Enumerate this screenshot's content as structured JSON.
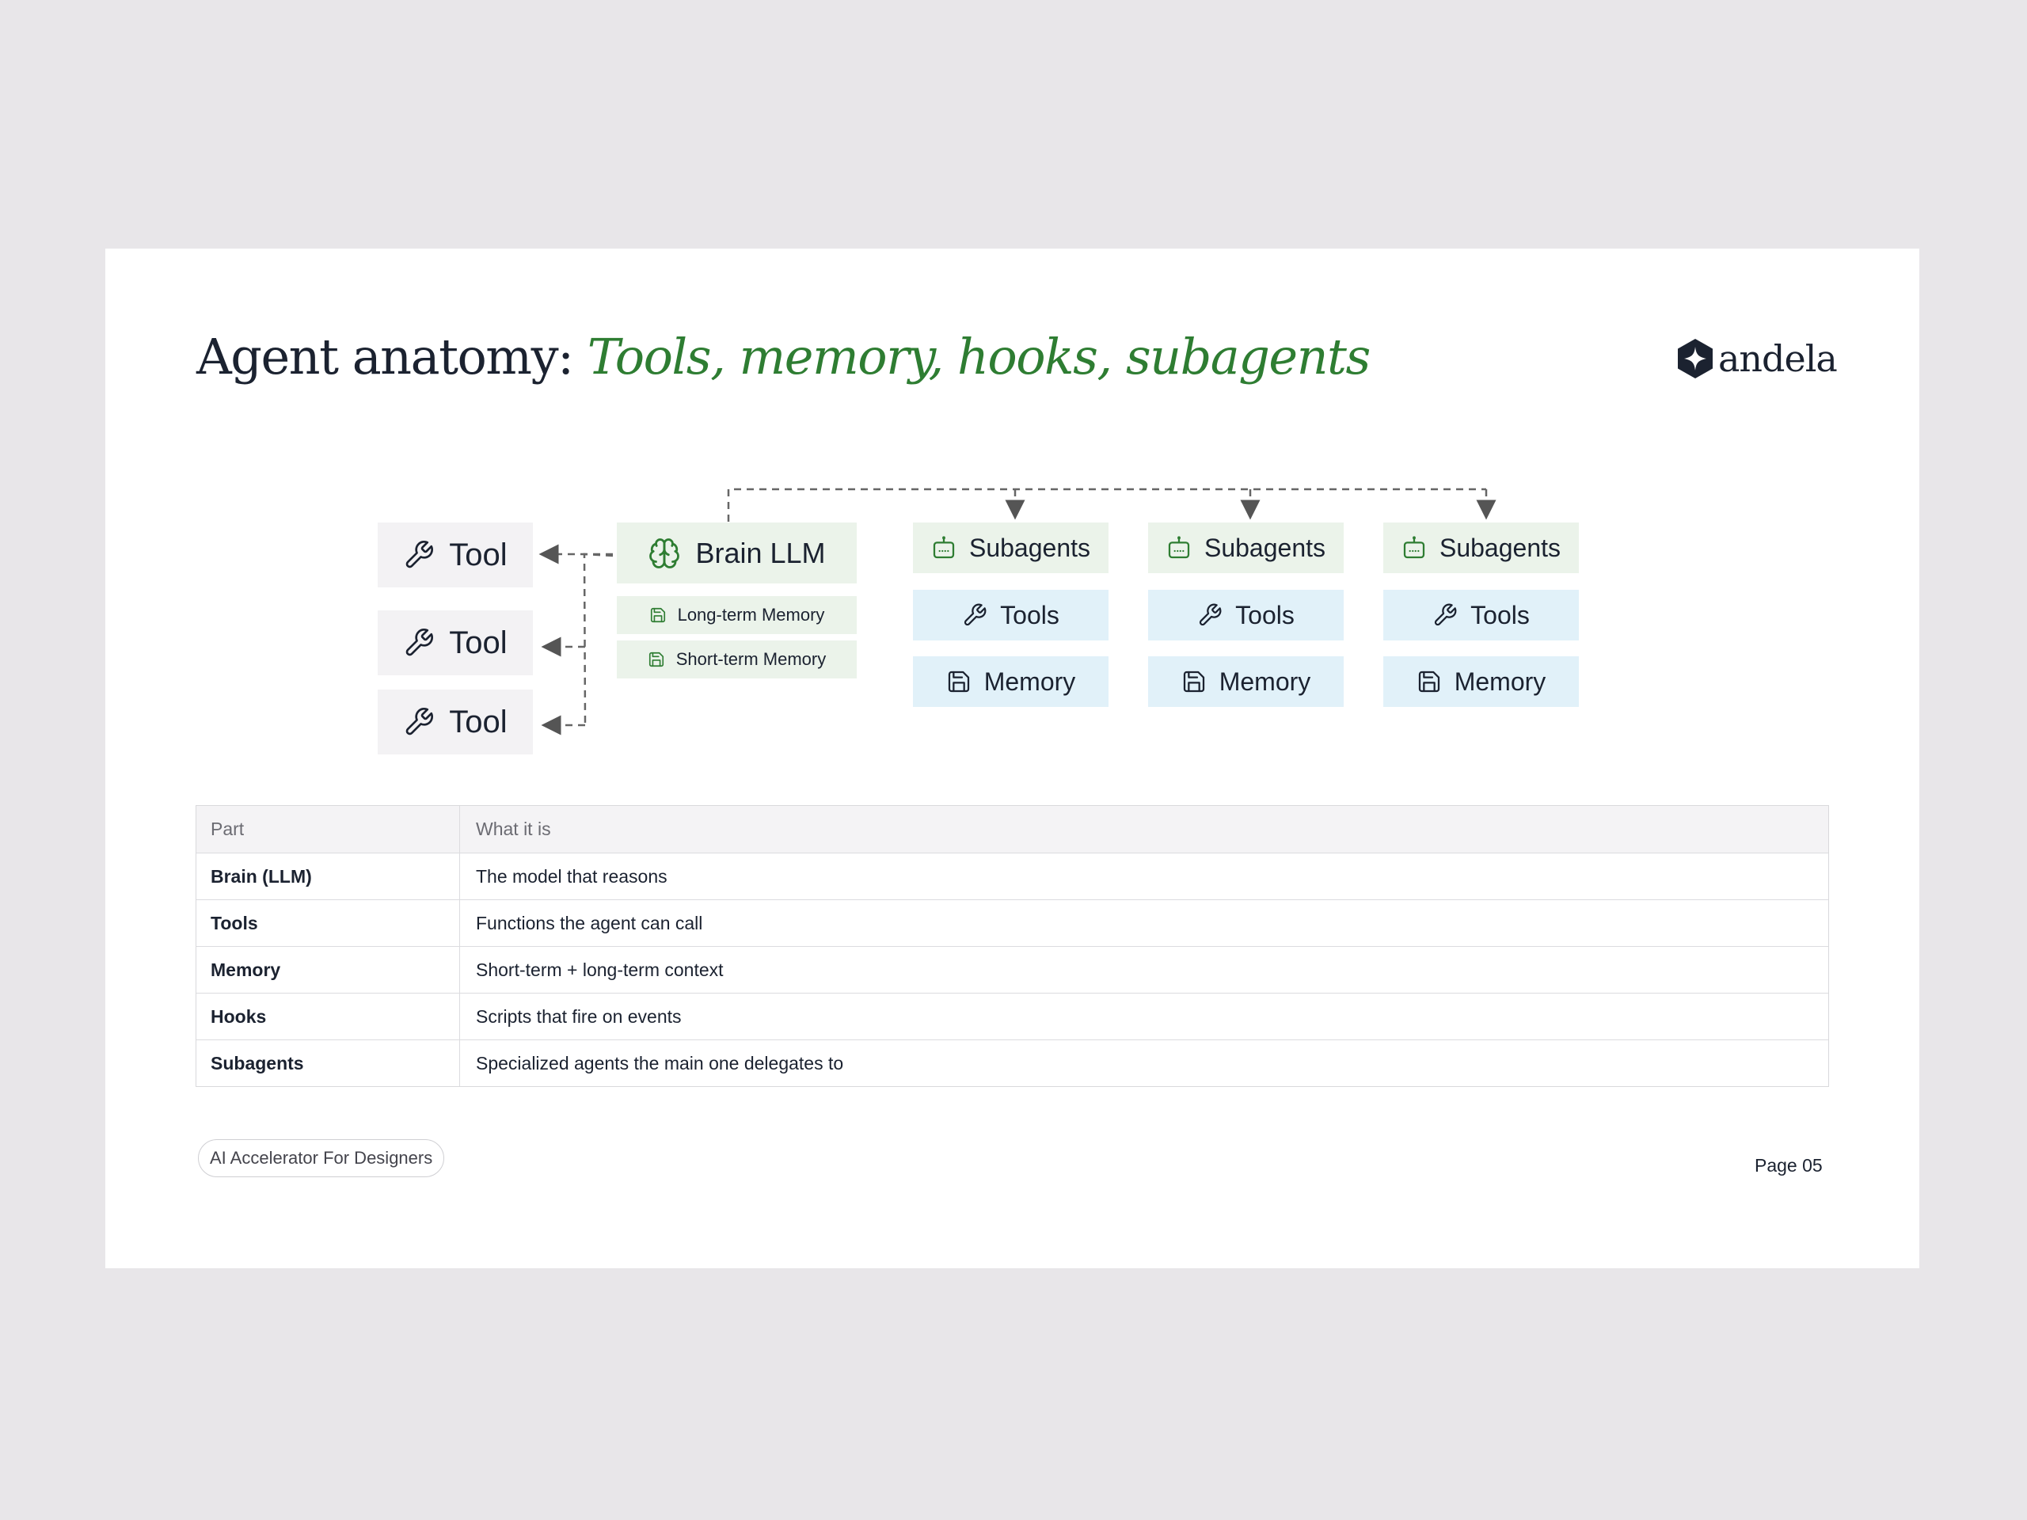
{
  "slide": {
    "title": "Agent anatomy:",
    "title_accent": "Tools, memory, hooks, subagents",
    "logo_text": "andela",
    "footer_tag": "AI Accelerator For Designers",
    "page_label": "Page 05"
  },
  "diagram": {
    "tools": [
      "Tool",
      "Tool",
      "Tool"
    ],
    "brain": "Brain LLM",
    "brain_memory": [
      "Long-term Memory",
      "Short-term Memory"
    ],
    "subagent_columns": [
      {
        "subagents": "Subagents",
        "tools": "Tools",
        "memory": "Memory"
      },
      {
        "subagents": "Subagents",
        "tools": "Tools",
        "memory": "Memory"
      },
      {
        "subagents": "Subagents",
        "tools": "Tools",
        "memory": "Memory"
      }
    ]
  },
  "table": {
    "headers": [
      "Part",
      "What it is"
    ],
    "rows": [
      [
        "Brain (LLM)",
        "The model that reasons"
      ],
      [
        "Tools",
        "Functions the agent can call"
      ],
      [
        "Memory",
        "Short-term + long-term context"
      ],
      [
        "Hooks",
        "Scripts that fire on events"
      ],
      [
        "Subagents",
        "Specialized agents the main one delegates to"
      ]
    ]
  },
  "colors": {
    "accent": "#2e7d32",
    "green_box": "#ebf3ea",
    "blue_box": "#e1f1f9",
    "gray_box": "#f3f2f4",
    "ink": "#1b2230"
  },
  "icons": {
    "tool": "wrench-icon",
    "brain": "brain-icon",
    "memory": "floppy-disk-icon",
    "subagent": "robot-icon",
    "logo": "andela-logo-icon"
  }
}
